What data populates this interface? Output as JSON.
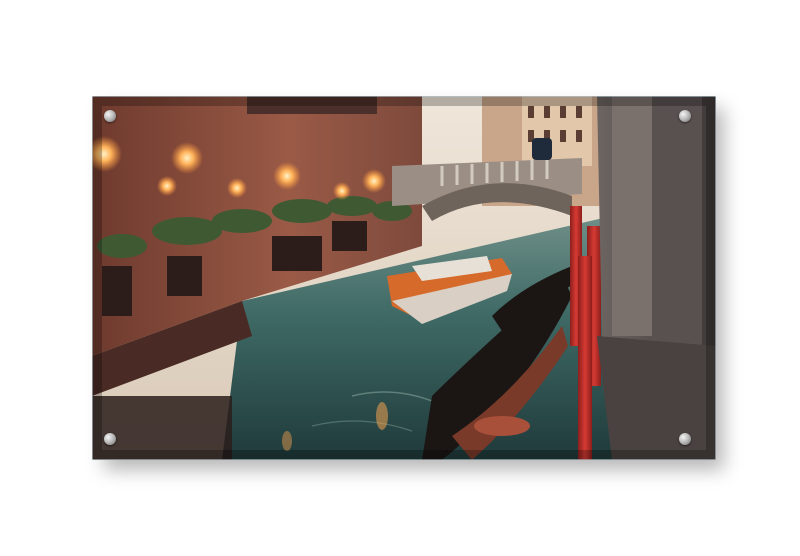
{
  "scene": {
    "subject": "",
    "colors": {
      "wall_left": "#8a4a3a",
      "wall_right": "#5d5552",
      "water": "#3f6a66",
      "sky": "#e9e0d6",
      "pole_red": "#c8322d",
      "lamp_glow": "#ffb35a",
      "boat_hull": "#d9cfc4",
      "boat_deck": "#d66a2a"
    }
  }
}
